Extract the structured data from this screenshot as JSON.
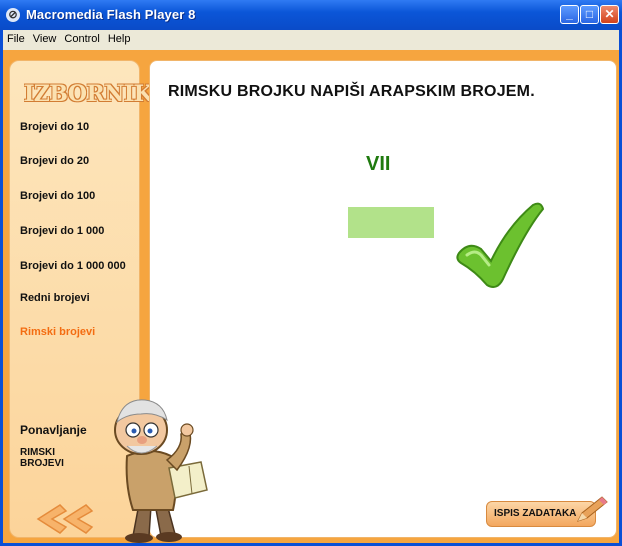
{
  "window": {
    "title": "Macromedia Flash Player 8",
    "app_icon_glyph": "⊘",
    "buttons": {
      "minimize": "_",
      "maximize": "□",
      "close": "✕"
    }
  },
  "menubar": {
    "items": [
      "File",
      "View",
      "Control",
      "Help"
    ]
  },
  "sidebar": {
    "heading": "IZBORNIK",
    "items": [
      {
        "label": "Brojevi do 10"
      },
      {
        "label": "Brojevi do 20"
      },
      {
        "label": "Brojevi do 100"
      },
      {
        "label": "Brojevi do 1 000"
      },
      {
        "label": "Brojevi do 1 000 000"
      },
      {
        "label": "Redni brojevi"
      },
      {
        "label": "Rimski brojevi",
        "active": true
      }
    ],
    "repeat_label": "Ponavljanje",
    "repeat_topic": "RIMSKI BROJEVI",
    "back_icon": "double-chevron-left-icon"
  },
  "main": {
    "prompt": "RIMSKU BROJKU NAPIŠI ARAPSKIM BROJEM.",
    "roman_numeral": "VII",
    "answer_value": "",
    "result_icon": "checkmark-icon",
    "print_button": "ISPIS ZADATAKA",
    "print_icon": "pencil-icon"
  },
  "colors": {
    "frame_orange": "#f6a53f",
    "active_item": "#f36d12",
    "numeral_green": "#1f7a0e",
    "answer_field": "#b2e28a",
    "checkmark_green": "#6cc12f"
  }
}
